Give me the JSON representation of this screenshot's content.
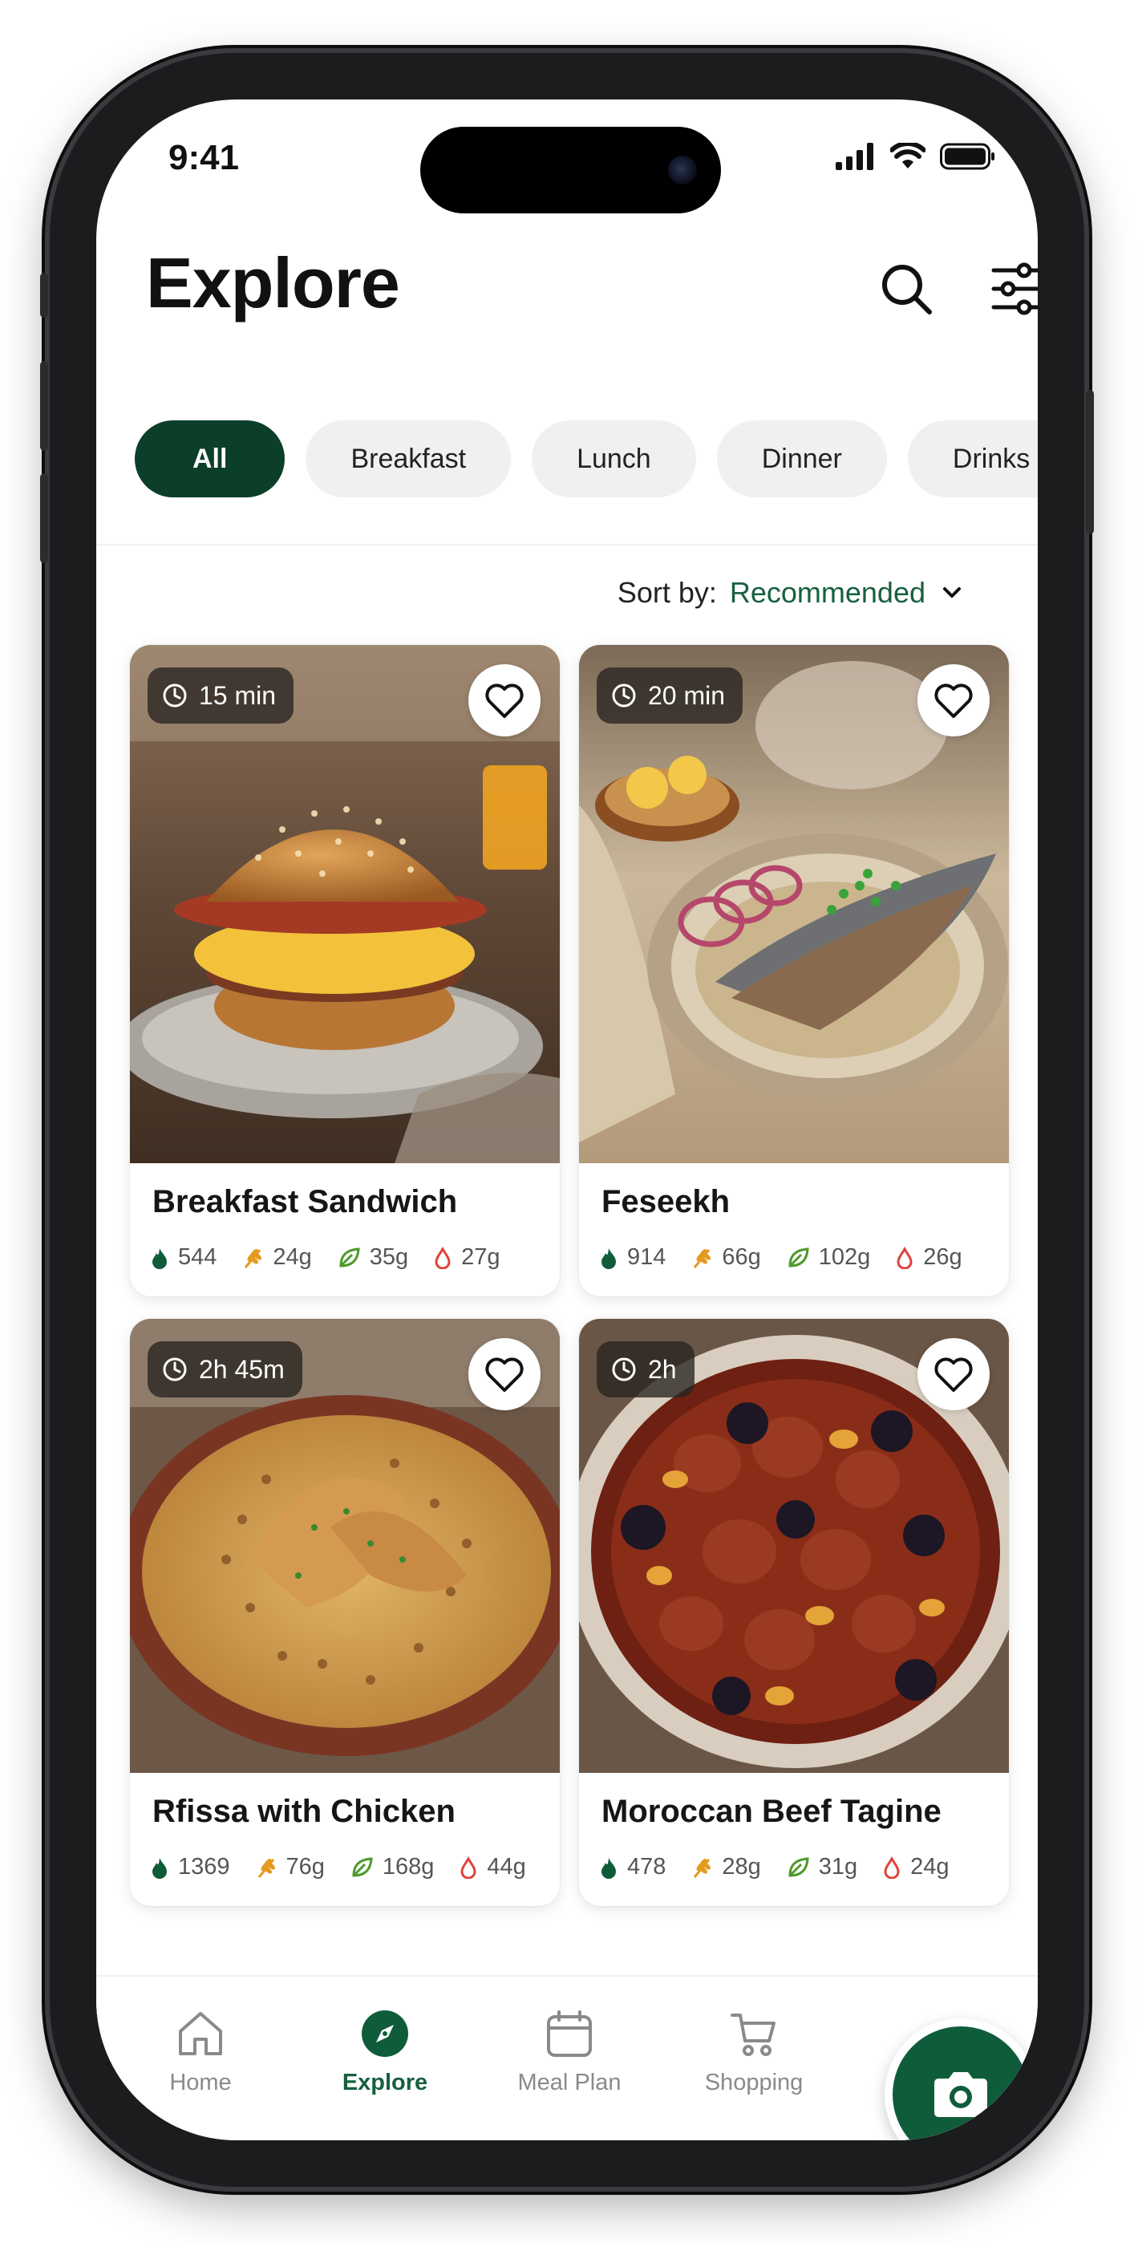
{
  "status_bar": {
    "time": "9:41"
  },
  "header": {
    "title": "Explore"
  },
  "chips": [
    "All",
    "Breakfast",
    "Lunch",
    "Dinner",
    "Drinks"
  ],
  "sort": {
    "label": "Sort by:",
    "value": "Recommended"
  },
  "recipes": [
    {
      "title": "Breakfast Sandwich",
      "time": "15 min",
      "calories": "544",
      "carbs": "24g",
      "fiber": "35g",
      "fat": "27g"
    },
    {
      "title": "Feseekh",
      "time": "20 min",
      "calories": "914",
      "carbs": "66g",
      "fiber": "102g",
      "fat": "26g"
    },
    {
      "title": "Rfissa with Chicken",
      "time": "2h 45m",
      "calories": "1369",
      "carbs": "76g",
      "fiber": "168g",
      "fat": "44g"
    },
    {
      "title": "Moroccan Beef Tagine",
      "time": "2h",
      "calories": "478",
      "carbs": "28g",
      "fiber": "31g",
      "fat": "24g"
    }
  ],
  "bottom_nav": {
    "home": "Home",
    "explore": "Explore",
    "meal_plan": "Meal Plan",
    "shopping": "Shopping"
  },
  "colors": {
    "accent": "#0c3f2a",
    "accent_text": "#17603f"
  }
}
